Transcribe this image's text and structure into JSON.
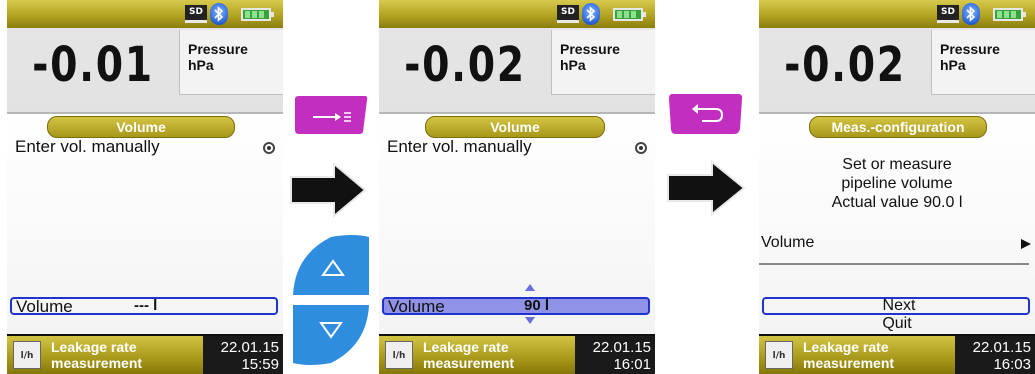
{
  "screens": [
    {
      "value": "-0.01",
      "unit_name": "Pressure",
      "unit": "hPa",
      "menu_title": "Volume",
      "option_label": "Enter vol. manually",
      "field_label": "Volume",
      "field_value": "--- l",
      "status_line1": "Leakage rate",
      "status_line2": "measurement",
      "date": "22.01.15",
      "time": "15:59",
      "sd_label": "SD"
    },
    {
      "value": "-0.02",
      "unit_name": "Pressure",
      "unit": "hPa",
      "menu_title": "Volume",
      "option_label": "Enter vol. manually",
      "field_label": "Volume",
      "field_value": "90 l",
      "status_line1": "Leakage rate",
      "status_line2": "measurement",
      "date": "22.01.15",
      "time": "16:01",
      "sd_label": "SD"
    },
    {
      "value": "-0.02",
      "unit_name": "Pressure",
      "unit": "hPa",
      "menu_title": "Meas.-configuration",
      "info_line1": "Set or measure",
      "info_line2": "pipeline volume",
      "info_line3": "Actual value  90.0 l",
      "volume_label": "Volume",
      "next_label": "Next",
      "quit_label": "Quit",
      "status_line1": "Leakage rate",
      "status_line2": "measurement",
      "date": "22.01.15",
      "time": "16:03",
      "sd_label": "SD"
    }
  ],
  "icons": {
    "bluetooth": "bluetooth-icon",
    "battery": "battery-icon",
    "sd": "sd-card-icon",
    "leak": "leakage-measurement-icon",
    "enter_key": "enter-key-icon",
    "back_key": "back-key-icon",
    "up_key": "up-arrow-key-icon",
    "down_key": "down-arrow-key-icon",
    "flow": "flow-arrow-icon"
  },
  "leak_icon_label": "l/h",
  "colors": {
    "softkey_magenta": "#c22ec0",
    "softkey_blue": "#2f8de0",
    "status_gold": "#b3a420",
    "field_border": "#2233cc",
    "field_highlight": "#8f92e6"
  }
}
